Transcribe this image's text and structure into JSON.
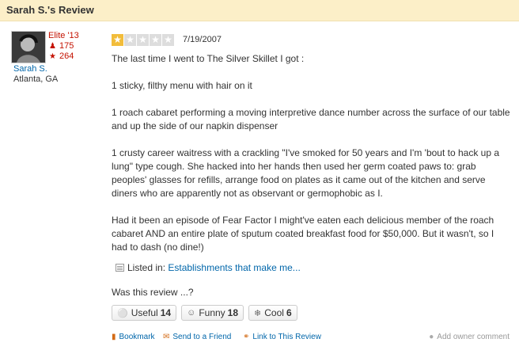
{
  "header": {
    "title": "Sarah S.'s Review"
  },
  "user": {
    "name": "Sarah S.",
    "location": "Atlanta, GA",
    "elite": "Elite '13",
    "friends": "175",
    "reviews": "264"
  },
  "review": {
    "rating": 1,
    "max_rating": 5,
    "date": "7/19/2007",
    "paragraphs": [
      "The last time I went to The Silver Skillet I got :",
      "1 sticky, filthy menu with hair on it",
      "1 roach cabaret performing a moving interpretive dance number across the surface of our table and up the side of our napkin dispenser",
      "1 crusty career waitress with a crackling \"I've smoked for 50 years and I'm 'bout to hack up a lung\" type cough.  She hacked into her hands then used her germ coated paws to: grab peoples' glasses for refills, arrange food on plates as it came out of the kitchen and serve diners who are apparently not as observant or germophobic as I.",
      "Had it been an episode of Fear Factor I might've eaten each delicious member of the roach cabaret AND an entire plate of sputum coated breakfast food for $50,000.  But it wasn't, so I had to dash (no dine!)"
    ]
  },
  "listed": {
    "prefix": "Listed in:",
    "link": "Establishments that make me..."
  },
  "feedback": {
    "prompt": "Was this review ...?",
    "useful_label": "Useful",
    "useful_count": "14",
    "funny_label": "Funny",
    "funny_count": "18",
    "cool_label": "Cool",
    "cool_count": "6"
  },
  "actions": {
    "bookmark": "Bookmark",
    "send": "Send to a Friend",
    "link": "Link to This Review",
    "owner_comment": "Add owner comment"
  },
  "colors": {
    "brand_red": "#c41200",
    "link": "#0066aa",
    "star": "#f2bd3b",
    "header_bg": "#fcefc8"
  }
}
